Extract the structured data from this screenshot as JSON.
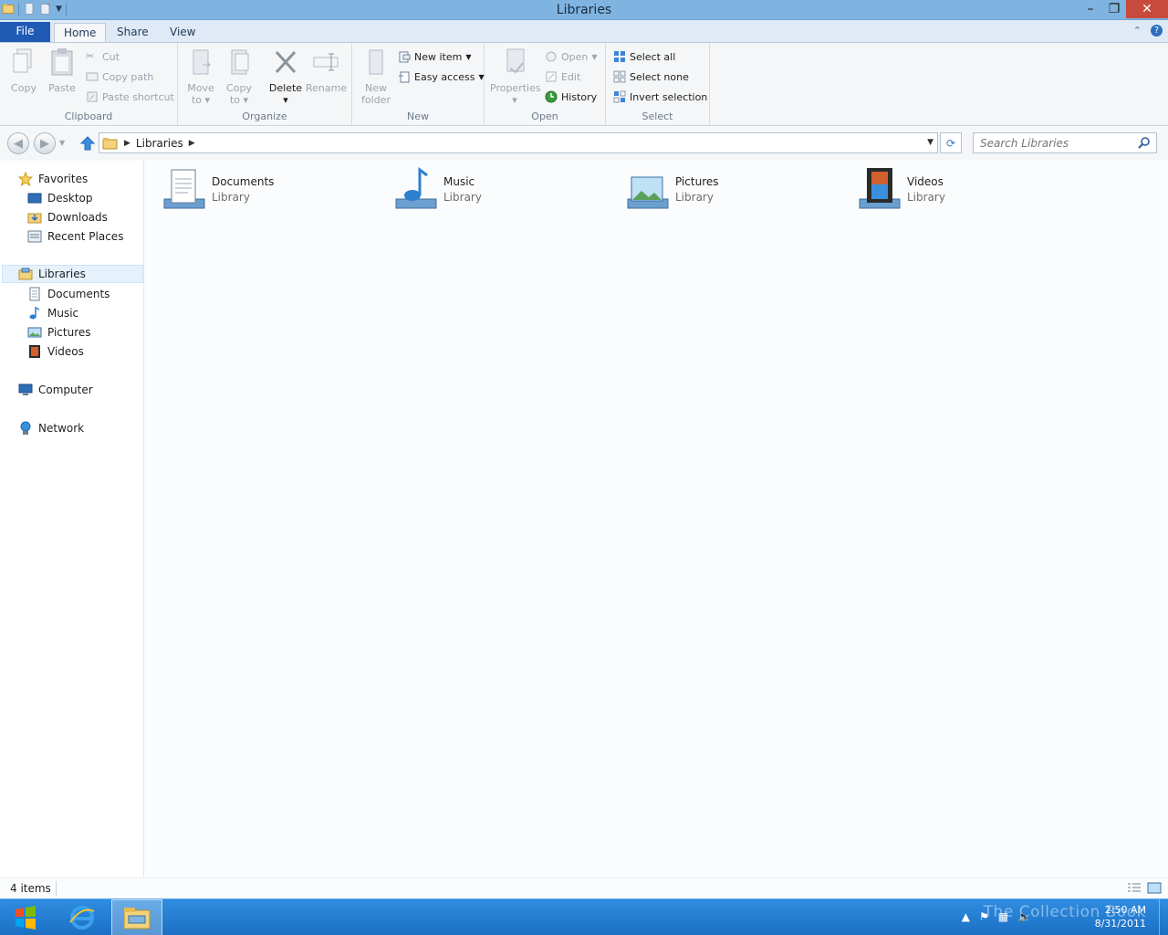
{
  "window": {
    "title": "Libraries"
  },
  "tabs": {
    "file": "File",
    "home": "Home",
    "share": "Share",
    "view": "View"
  },
  "clipboard": {
    "copy": "Copy",
    "paste": "Paste",
    "cut": "Cut",
    "copy_path": "Copy path",
    "paste_shortcut": "Paste shortcut",
    "label": "Clipboard"
  },
  "organize": {
    "move_to_1": "Move",
    "move_to_2": "to",
    "copy_to_1": "Copy",
    "copy_to_2": "to",
    "delete": "Delete",
    "rename": "Rename",
    "label": "Organize"
  },
  "new": {
    "new_folder_1": "New",
    "new_folder_2": "folder",
    "new_item": "New item",
    "easy_access": "Easy access",
    "label": "New"
  },
  "open": {
    "properties": "Properties",
    "open": "Open",
    "edit": "Edit",
    "history": "History",
    "label": "Open"
  },
  "select": {
    "select_all": "Select all",
    "select_none": "Select none",
    "invert": "Invert selection",
    "label": "Select"
  },
  "address": {
    "crumb": "Libraries"
  },
  "search": {
    "placeholder": "Search Libraries"
  },
  "nav": {
    "favorites": "Favorites",
    "desktop": "Desktop",
    "downloads": "Downloads",
    "recent": "Recent Places",
    "libraries": "Libraries",
    "documents": "Documents",
    "music": "Music",
    "pictures": "Pictures",
    "videos": "Videos",
    "computer": "Computer",
    "network": "Network"
  },
  "libraries": [
    {
      "name": "Documents",
      "type": "Library",
      "icon": "documents-library-icon"
    },
    {
      "name": "Music",
      "type": "Library",
      "icon": "music-library-icon"
    },
    {
      "name": "Pictures",
      "type": "Library",
      "icon": "pictures-library-icon"
    },
    {
      "name": "Videos",
      "type": "Library",
      "icon": "videos-library-icon"
    }
  ],
  "status": {
    "count": "4 items"
  },
  "taskbar": {
    "time": "2:50 AM",
    "date": "8/31/2011",
    "watermark": "The Collection Book"
  },
  "colors": {
    "file_tab": "#1f5bb5",
    "titlebar": "#7fb4e0",
    "taskbar": "#1b6fc4",
    "close": "#c74b3d"
  }
}
